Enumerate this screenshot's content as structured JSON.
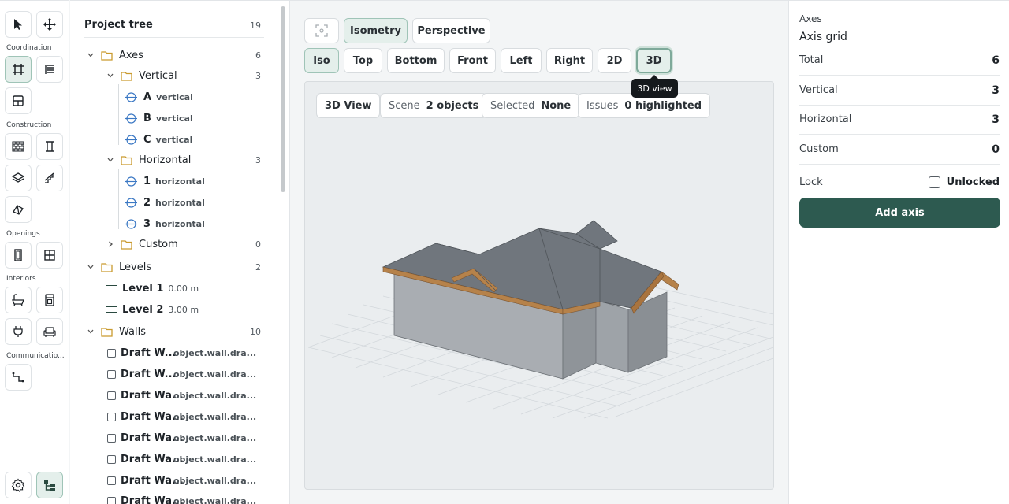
{
  "toolbar": {
    "groups": {
      "coordination": "Coordination",
      "construction": "Construction",
      "openings": "Openings",
      "interiors": "Interiors",
      "communications": "Communicatio..."
    }
  },
  "tree": {
    "title": "Project tree",
    "count": "19",
    "axes": {
      "label": "Axes",
      "count": "6"
    },
    "vertical": {
      "label": "Vertical",
      "count": "3",
      "items": [
        {
          "name": "A",
          "type": "vertical"
        },
        {
          "name": "B",
          "type": "vertical"
        },
        {
          "name": "C",
          "type": "vertical"
        }
      ]
    },
    "horizontal": {
      "label": "Horizontal",
      "count": "3",
      "items": [
        {
          "name": "1",
          "type": "horizontal"
        },
        {
          "name": "2",
          "type": "horizontal"
        },
        {
          "name": "3",
          "type": "horizontal"
        }
      ]
    },
    "custom": {
      "label": "Custom",
      "count": "0"
    },
    "levels": {
      "label": "Levels",
      "count": "2",
      "items": [
        {
          "name": "Level 1",
          "elev": "0.00 m"
        },
        {
          "name": "Level 2",
          "elev": "3.00 m"
        }
      ]
    },
    "walls": {
      "label": "Walls",
      "count": "10",
      "items": [
        {
          "name": "Draft W...",
          "id": "object.wall.dra..."
        },
        {
          "name": "Draft W...",
          "id": "object.wall.dra..."
        },
        {
          "name": "Draft Wa...",
          "id": "object.wall.dra..."
        },
        {
          "name": "Draft Wa...",
          "id": "object.wall.dra..."
        },
        {
          "name": "Draft Wa...",
          "id": "object.wall.dra..."
        },
        {
          "name": "Draft Wa...",
          "id": "object.wall.dra..."
        },
        {
          "name": "Draft Wa...",
          "id": "object.wall.dra..."
        },
        {
          "name": "Draft Wa...",
          "id": "object.wall.dra..."
        }
      ]
    }
  },
  "view": {
    "projection": [
      "Isometry",
      "Perspective"
    ],
    "presets": [
      "Iso",
      "Top",
      "Bottom",
      "Front",
      "Left",
      "Right",
      "2D",
      "3D"
    ],
    "tooltip": "3D view",
    "chips": {
      "view": "3D View",
      "scene_label": "Scene",
      "scene_value": "2 objects",
      "selected_label": "Selected",
      "selected_value": "None",
      "issues_label": "Issues",
      "issues_value": "0 highlighted"
    }
  },
  "panel": {
    "section": "Axes",
    "title": "Axis grid",
    "rows": [
      {
        "k": "Total",
        "v": "6"
      },
      {
        "k": "Vertical",
        "v": "3"
      },
      {
        "k": "Horizontal",
        "v": "3"
      },
      {
        "k": "Custom",
        "v": "0"
      }
    ],
    "lock_label": "Lock",
    "lock_state": "Unlocked",
    "add_button": "Add axis"
  }
}
